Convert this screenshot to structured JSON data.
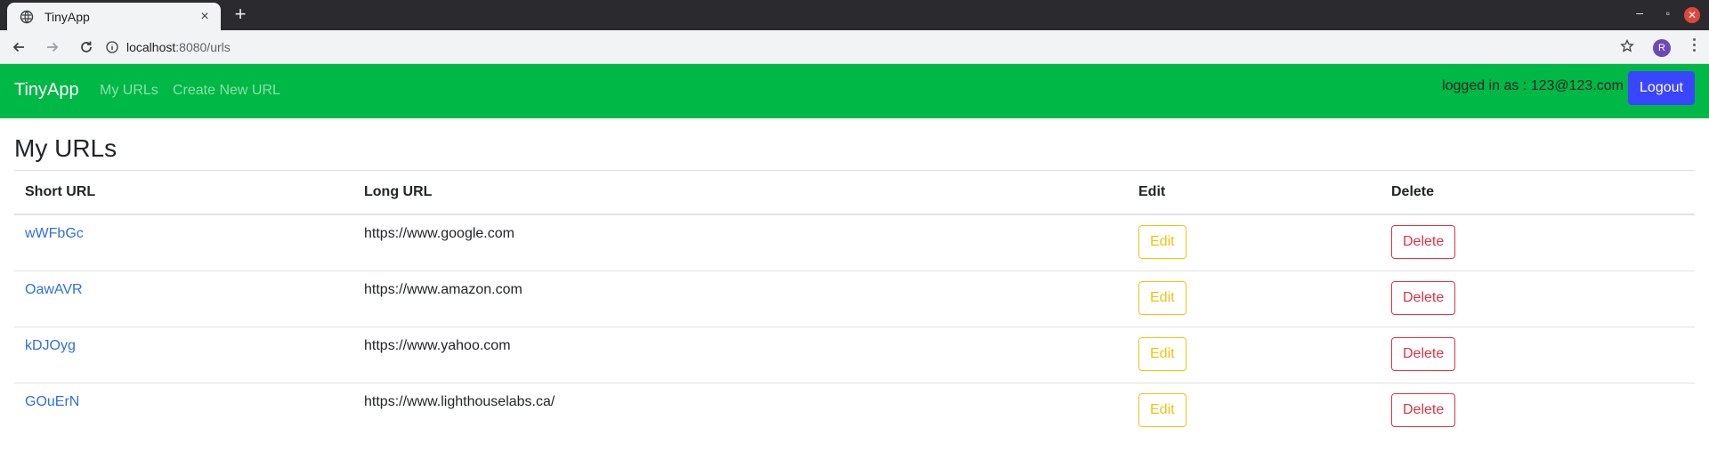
{
  "browser": {
    "tab_title": "TinyApp",
    "tab_close": "×",
    "new_tab": "+",
    "url_host": "localhost",
    "url_rest": ":8080/urls",
    "profile_initial": "R",
    "window_min": "–",
    "window_max": "▫",
    "window_close": "✕"
  },
  "navbar": {
    "brand": "TinyApp",
    "links": [
      {
        "label": "My URLs"
      },
      {
        "label": "Create New URL"
      }
    ],
    "logged_in_text": "logged in as : 123@123.com",
    "logout_label": "Logout",
    "bg_color": "#00b845",
    "logout_color": "#3a45ff"
  },
  "main": {
    "title": "My URLs",
    "table": {
      "headers": [
        "Short URL",
        "Long URL",
        "Edit",
        "Delete"
      ],
      "rows": [
        {
          "short": "wWFbGc",
          "long": "https://www.google.com",
          "edit": "Edit",
          "delete": "Delete"
        },
        {
          "short": "OawAVR",
          "long": "https://www.amazon.com",
          "edit": "Edit",
          "delete": "Delete"
        },
        {
          "short": "kDJOyg",
          "long": "https://www.yahoo.com",
          "edit": "Edit",
          "delete": "Delete"
        },
        {
          "short": "GOuErN",
          "long": "https://www.lighthouselabs.ca/",
          "edit": "Edit",
          "delete": "Delete"
        }
      ]
    }
  }
}
